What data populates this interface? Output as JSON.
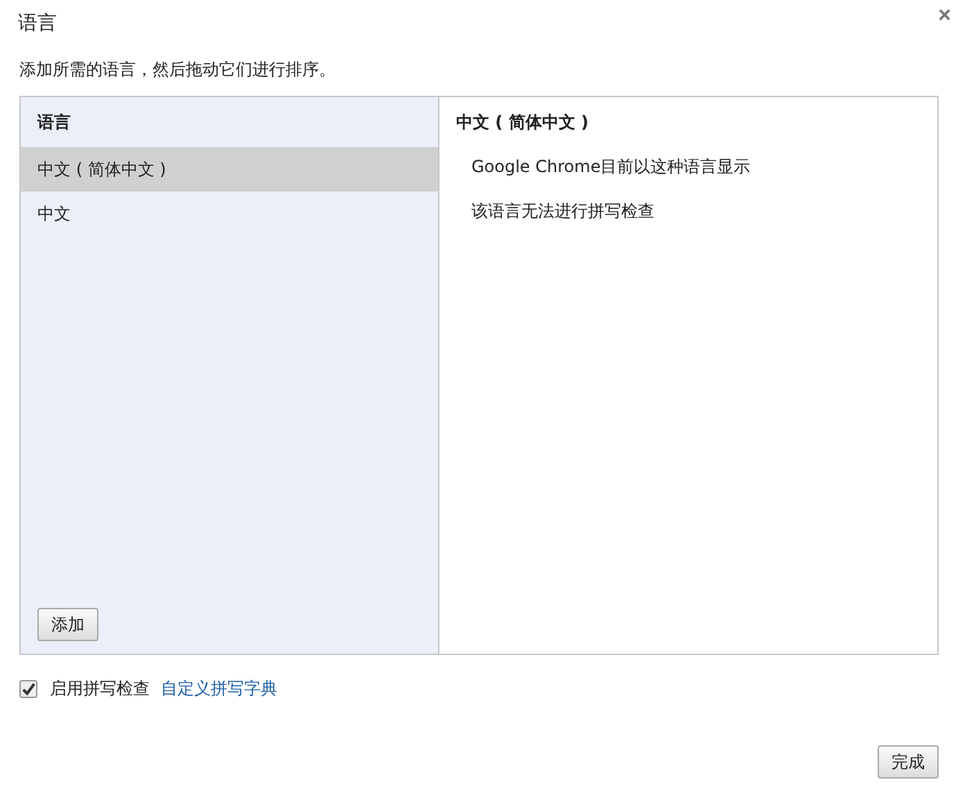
{
  "window": {
    "title": "语言",
    "close": "×"
  },
  "instruction": "添加所需的语言，然后拖动它们进行排序。",
  "language_list": {
    "header": "语言",
    "items": [
      {
        "label": "中文 ( 简体中文 )",
        "selected": true
      },
      {
        "label": "中文",
        "selected": false
      }
    ],
    "add_button": "添加"
  },
  "details": {
    "title": "中文 ( 简体中文 )",
    "lines": [
      "Google Chrome目前以这种语言显示",
      "该语言无法进行拼写检查"
    ]
  },
  "spellcheck": {
    "label": "启用拼写检查",
    "checked": true,
    "link": "自定义拼写字典"
  },
  "buttons": [
    "完成"
  ]
}
